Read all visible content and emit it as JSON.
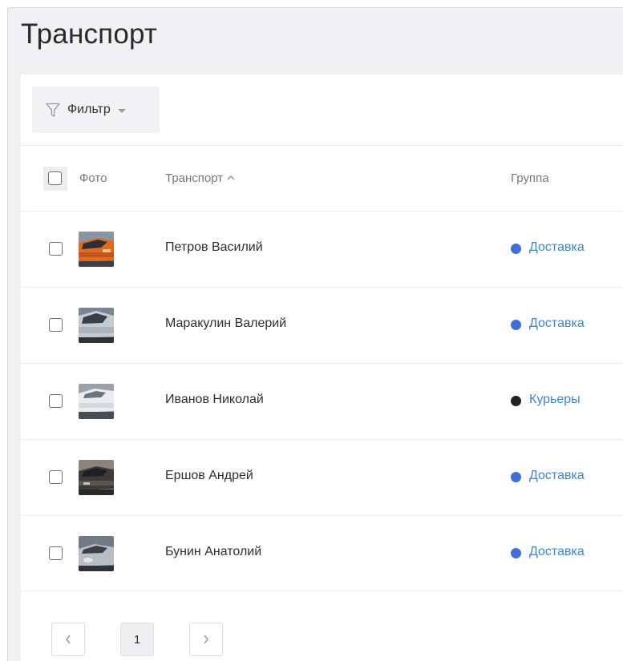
{
  "page": {
    "title": "Транспорт"
  },
  "toolbar": {
    "filter_label": "Фильтр"
  },
  "table": {
    "columns": {
      "photo": "Фото",
      "transport": "Транспорт",
      "group": "Группа"
    },
    "rows": [
      {
        "name": "Петров Василий",
        "group": "Доставка",
        "group_color": "#3f6fd9"
      },
      {
        "name": "Маракулин Валерий",
        "group": "Доставка",
        "group_color": "#3f6fd9"
      },
      {
        "name": "Иванов Николай",
        "group": "Курьеры",
        "group_color": "#222222"
      },
      {
        "name": "Ершов Андрей",
        "group": "Доставка",
        "group_color": "#3f6fd9"
      },
      {
        "name": "Бунин Анатолий",
        "group": "Доставка",
        "group_color": "#3f6fd9"
      }
    ]
  },
  "pagination": {
    "current_page": "1"
  },
  "colors": {
    "link": "#3c86d0",
    "delivery_dot": "#3f6fd9",
    "couriers_dot": "#222222"
  }
}
